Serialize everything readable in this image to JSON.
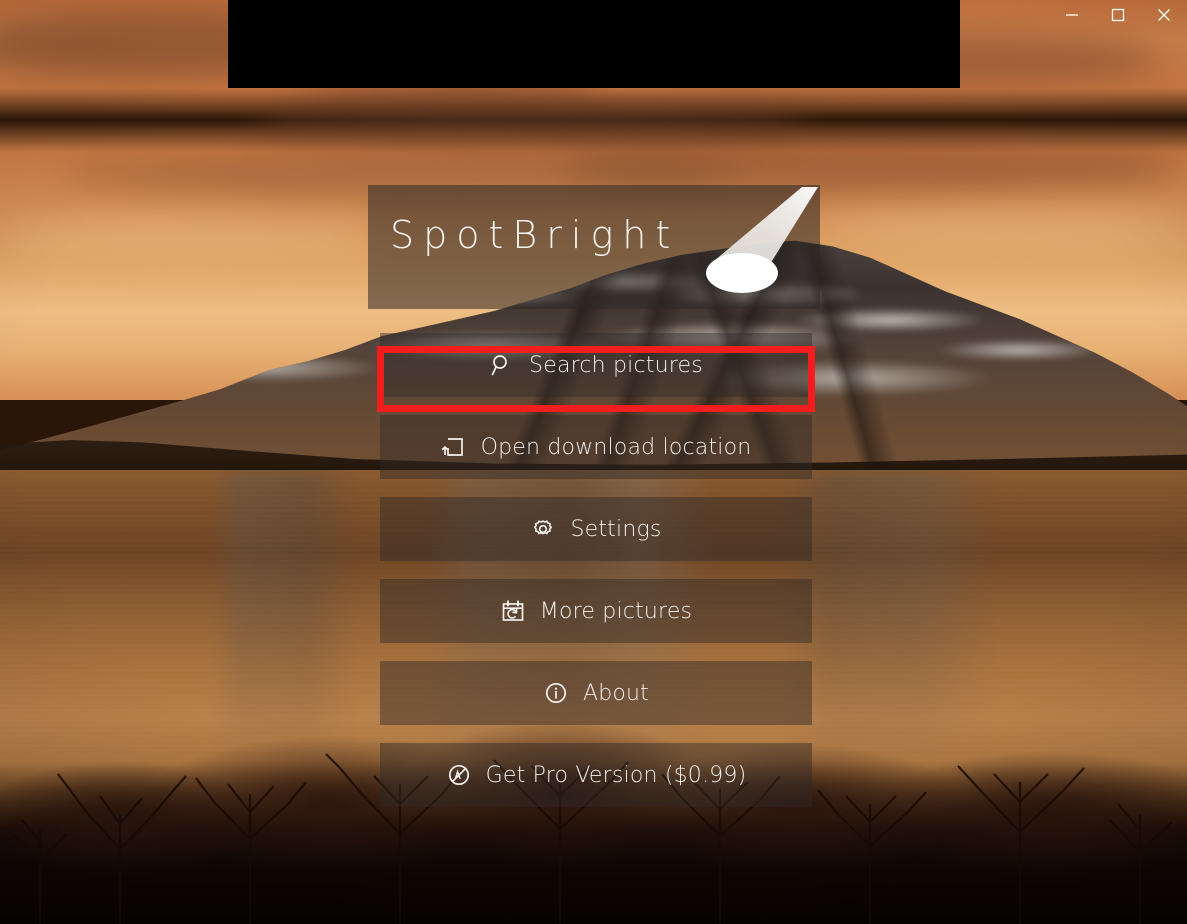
{
  "window": {
    "controls": [
      {
        "name": "minimize",
        "label": "Minimize",
        "glyph": "minimize-icon"
      },
      {
        "name": "maximize",
        "label": "Maximize",
        "glyph": "maximize-icon"
      },
      {
        "name": "close",
        "label": "Close",
        "glyph": "close-icon"
      }
    ]
  },
  "ad_panel": {
    "label": "",
    "background_color": "#000000"
  },
  "app": {
    "title": "SpotBright",
    "logo_icon": "spotlight-icon"
  },
  "menu": {
    "items": [
      {
        "label": "Search pictures",
        "icon": "search-icon",
        "highlighted": true
      },
      {
        "label": "Open download location",
        "icon": "open-folder-icon",
        "highlighted": false
      },
      {
        "label": "Settings",
        "icon": "gear-icon",
        "highlighted": false
      },
      {
        "label": "More pictures",
        "icon": "calendar-refresh-icon",
        "highlighted": false
      },
      {
        "label": "About",
        "icon": "info-icon",
        "highlighted": false
      },
      {
        "label": "Get Pro Version ($0.99)",
        "icon": "no-ads-icon",
        "highlighted": false
      }
    ]
  },
  "annotation": {
    "highlight_color": "#f21d1d",
    "target": "Search pictures"
  },
  "background": {
    "description": "Sunset mountain lake photograph",
    "sky_color": "#d4874f",
    "water_color": "#a8713d",
    "silhouette_color": "#1a0c06"
  }
}
